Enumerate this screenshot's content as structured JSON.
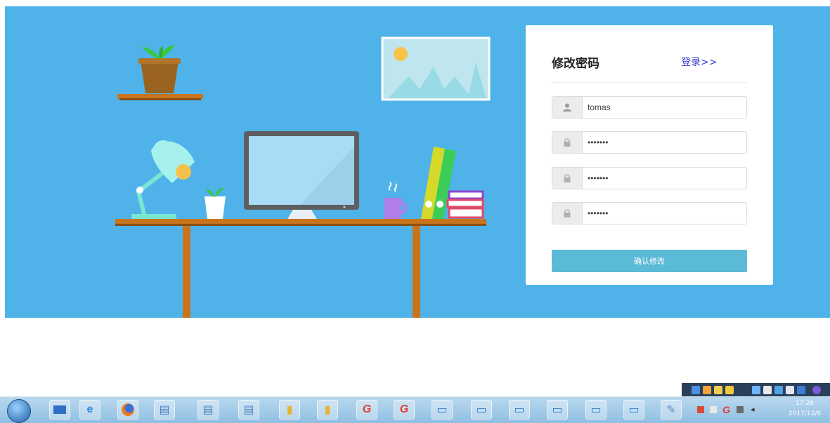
{
  "form": {
    "title": "修改密码",
    "login_link": "登录>>",
    "username_value": "tomas",
    "password_value": "•••••••",
    "new_password_value": "•••••••",
    "confirm_password_value": "•••••••",
    "submit_label": "确认修改"
  },
  "taskbar": {
    "clock_time": "17:26",
    "clock_date": "2017/12/6",
    "apps": [
      "show-desktop",
      "ie-browser",
      "firefox",
      "document",
      "document",
      "document",
      "folder",
      "folder",
      "red-g-app",
      "red-g-app",
      "window",
      "window",
      "window",
      "window",
      "window",
      "window",
      "paint-app"
    ]
  },
  "colors": {
    "background": "#4fb3ea",
    "accent_button": "#5bbad6",
    "link": "#3a3fd3"
  }
}
